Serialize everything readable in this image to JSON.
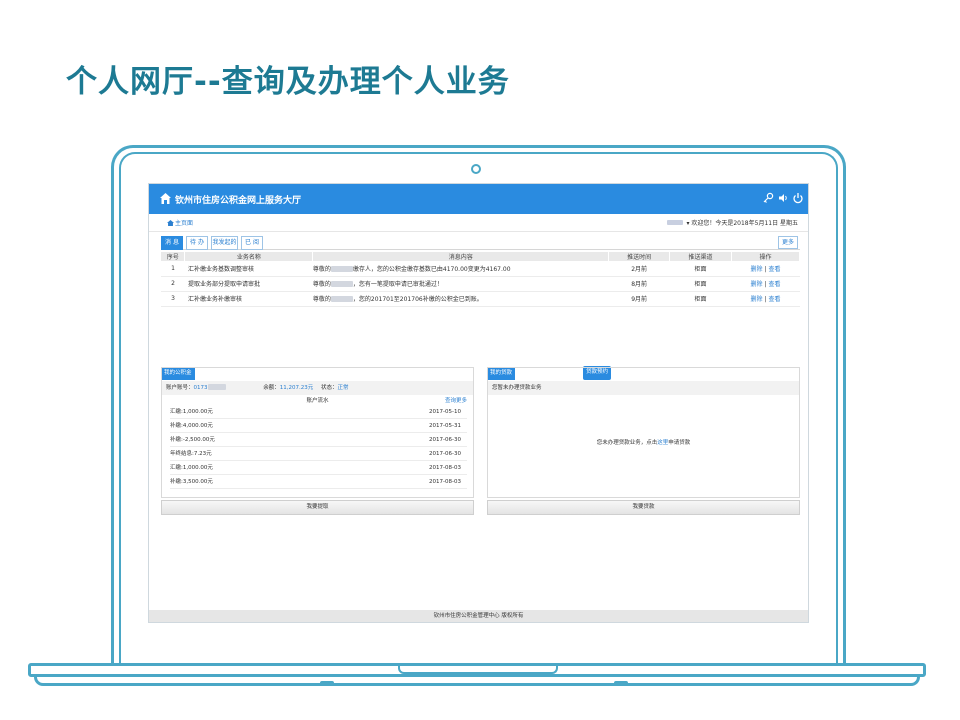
{
  "slide": {
    "title": "个人网厅--查询及办理个人业务"
  },
  "app": {
    "title": "钦州市住房公积金网上服务大厅",
    "header_icons": [
      "key-icon",
      "volume-icon",
      "power-icon"
    ]
  },
  "subbar": {
    "home": "主页面",
    "greeting": "▾  欢迎您！今天是2018年5月11日 星期五"
  },
  "tabs": [
    "消 息",
    "待 办",
    "我发起的",
    "已 阅"
  ],
  "more": "更多",
  "messages": {
    "headers": [
      "序号",
      "业务名称",
      "消息内容",
      "推送时间",
      "推送渠道",
      "操作"
    ],
    "rows": [
      {
        "no": "1",
        "name": "汇补缴业务基数调整审核",
        "pre": "尊敬的",
        "post": "缴存人，您的公积金缴存基数已由4170.00变更为4167.00",
        "time": "2月前",
        "channel": "柜面",
        "del": "删除",
        "sep": "|",
        "view": "查看"
      },
      {
        "no": "2",
        "name": "提取业务部分提取申请审批",
        "pre": "尊敬的",
        "post": "，您有一笔提取申请已审批通过！",
        "time": "8月前",
        "channel": "柜面",
        "del": "删除",
        "sep": "|",
        "view": "查看"
      },
      {
        "no": "3",
        "name": "汇补缴业务补缴审核",
        "pre": "尊敬的",
        "post": "，您的201701至201706补缴的公积金已到账。",
        "time": "9月前",
        "channel": "柜面",
        "del": "删除",
        "sep": "|",
        "view": "查看"
      }
    ]
  },
  "fund": {
    "tag": "我的公积金",
    "acct_label": "账户账号：",
    "acct_value": "0173",
    "bal_label": "余额：",
    "bal_value": "11,207.23元",
    "status_label": "状态：",
    "status_value": "正常",
    "flow_title": "账户流水",
    "flow_more": "查询更多",
    "rows": [
      {
        "desc": "汇缴:1,000.00元",
        "date": "2017-05-10"
      },
      {
        "desc": "补缴:4,000.00元",
        "date": "2017-05-31"
      },
      {
        "desc": "补缴:-2,500.00元",
        "date": "2017-06-30"
      },
      {
        "desc": "年终结息:7.23元",
        "date": "2017-06-30"
      },
      {
        "desc": "汇缴:1,000.00元",
        "date": "2017-08-03"
      },
      {
        "desc": "补缴:3,500.00元",
        "date": "2017-08-03"
      }
    ],
    "button": "我要提取"
  },
  "loan": {
    "tag": "我的贷款",
    "tag2": "贷款预约",
    "head": "您暂未办理贷款业务",
    "msg_a": "您未办理贷款业务，点击",
    "msg_link": "这里",
    "msg_b": "申请贷款",
    "button": "我要贷款"
  },
  "footer": "钦州市住房公积金管理中心 版权所有"
}
